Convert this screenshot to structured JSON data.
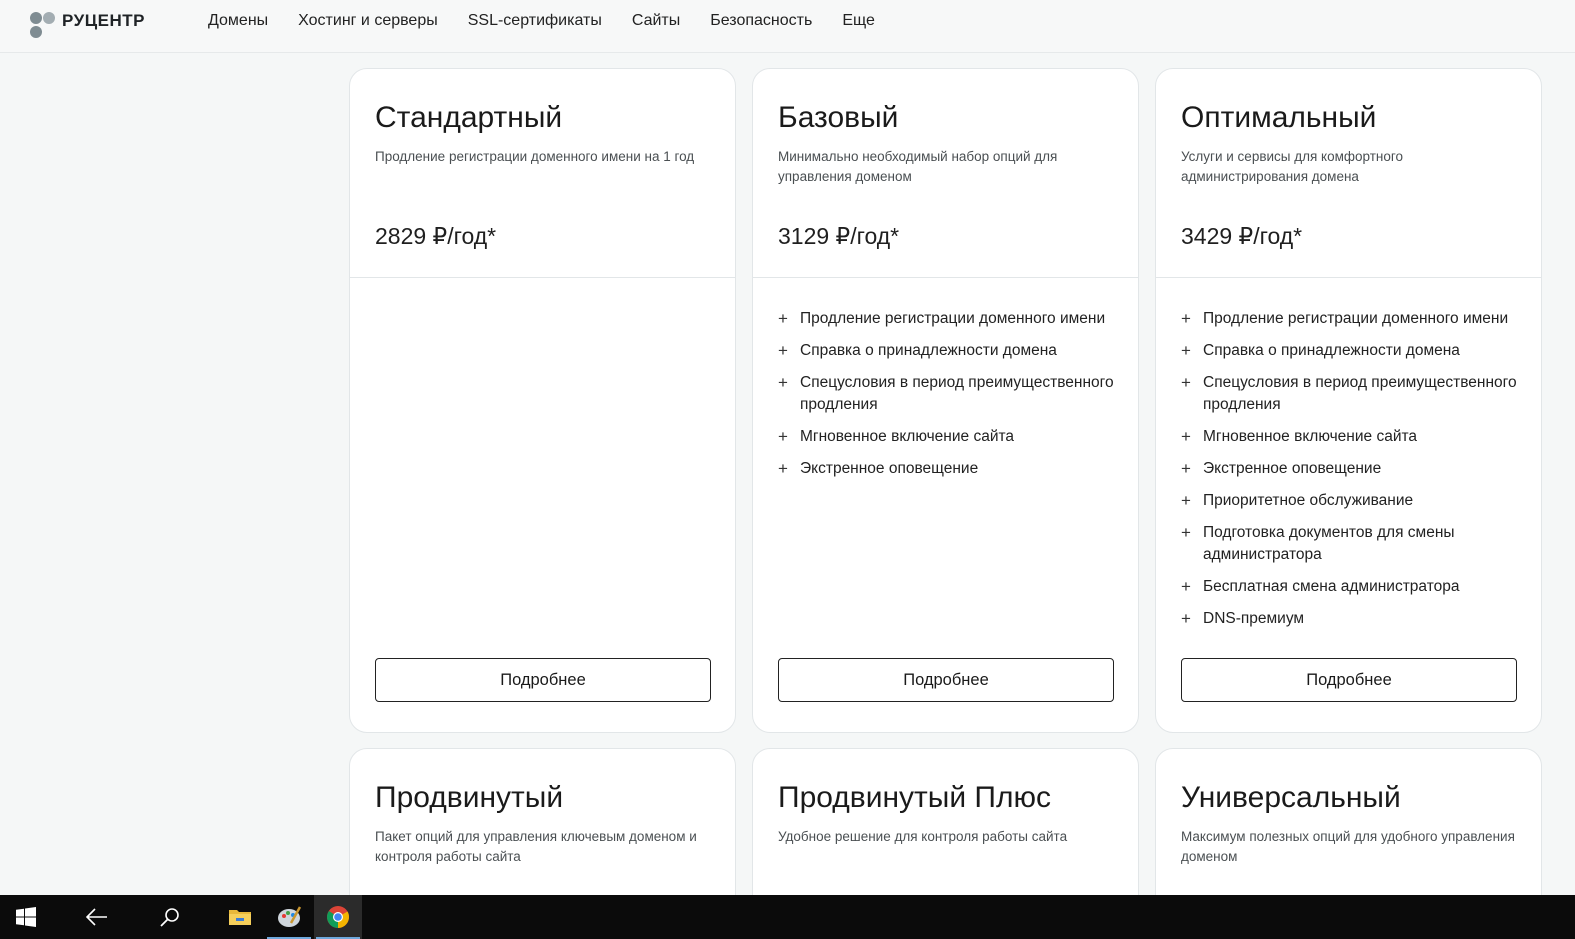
{
  "header": {
    "logo_text": "РУЦЕНТР",
    "nav": [
      "Домены",
      "Хостинг и серверы",
      "SSL-сертификаты",
      "Сайты",
      "Безопасность",
      "Еще"
    ]
  },
  "plans": [
    {
      "title": "Стандартный",
      "description": "Продление регистрации доменного имени на 1 год",
      "price": "2829 ₽/год*",
      "features": [],
      "button": "Подробнее"
    },
    {
      "title": "Базовый",
      "description": "Минимально необходимый набор опций для управления доменом",
      "price": "3129 ₽/год*",
      "features": [
        "Продление регистрации доменного имени",
        "Справка о принадлежности домена",
        "Спецусловия в период преимущественного продления",
        "Мгновенное включение сайта",
        "Экстренное оповещение"
      ],
      "button": "Подробнее"
    },
    {
      "title": "Оптимальный",
      "description": "Услуги и сервисы для комфортного администрирования домена",
      "price": "3429 ₽/год*",
      "features": [
        "Продление регистрации доменного имени",
        "Справка о принадлежности домена",
        "Спецусловия в период преимущественного продления",
        "Мгновенное включение сайта",
        "Экстренное оповещение",
        "Приоритетное обслуживание",
        "Подготовка документов для смены администратора",
        "Бесплатная смена администратора",
        "DNS-премиум"
      ],
      "button": "Подробнее"
    },
    {
      "title": "Продвинутый",
      "description": "Пакет опций для управления ключевым доменом и контроля работы сайта"
    },
    {
      "title": "Продвинутый Плюс",
      "description": "Удобное решение для контроля работы сайта"
    },
    {
      "title": "Универсальный",
      "description": "Максимум полезных опций для удобного управления доменом"
    }
  ],
  "feature_icon": "plus-icon",
  "taskbar": {
    "items": [
      "windows-start-icon",
      "back-arrow-icon",
      "search-icon",
      "file-explorer-icon",
      "paint-icon",
      "chrome-icon"
    ]
  }
}
